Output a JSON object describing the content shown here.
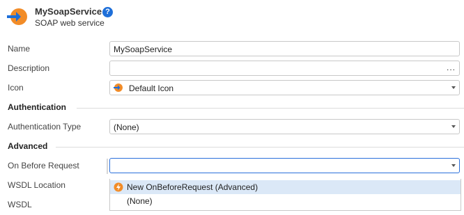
{
  "header": {
    "title": "MySoapService",
    "subtitle": "SOAP web service",
    "help": "?"
  },
  "fields": {
    "name": {
      "label": "Name",
      "value": "MySoapService"
    },
    "description": {
      "label": "Description",
      "value": "",
      "more": "..."
    },
    "icon": {
      "label": "Icon",
      "value": "Default Icon"
    }
  },
  "sections": {
    "authentication": "Authentication",
    "advanced": "Advanced"
  },
  "authentication_type": {
    "label": "Authentication Type",
    "value": "(None)"
  },
  "on_before_request": {
    "label": "On Before Request",
    "value": ""
  },
  "wsdl_location": {
    "label": "WSDL Location"
  },
  "wsdl": {
    "label": "WSDL"
  },
  "dropdown_options": [
    "New OnBeforeRequest (Advanced)",
    "(None)"
  ],
  "colors": {
    "accent": "#f28c28",
    "icon_blue": "#1e6fd9",
    "selection": "#dbe8f7"
  }
}
